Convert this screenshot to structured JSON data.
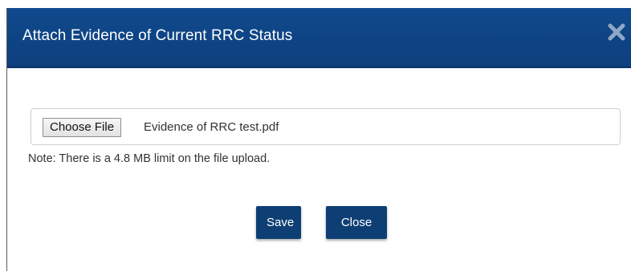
{
  "dialog": {
    "title": "Attach Evidence of Current RRC Status",
    "close_icon": "close-icon"
  },
  "file_input": {
    "button_label": "Choose File",
    "file_name": "Evidence of RRC test.pdf"
  },
  "note": "Note: There is a 4.8 MB limit on the file upload.",
  "actions": {
    "save_label": "Save",
    "close_label": "Close"
  },
  "colors": {
    "header": "#104a8e",
    "button": "#0e3f74"
  }
}
